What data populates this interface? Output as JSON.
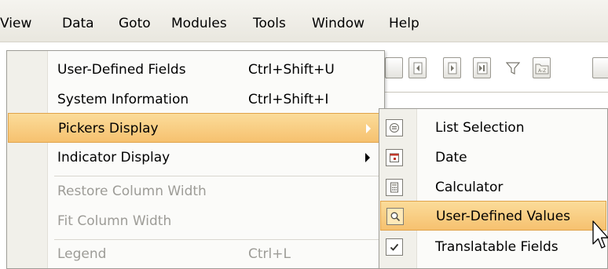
{
  "menubar": {
    "items": [
      {
        "label": "View"
      },
      {
        "label": "Data"
      },
      {
        "label": "Goto"
      },
      {
        "label": "Modules"
      },
      {
        "label": "Tools"
      },
      {
        "label": "Window"
      },
      {
        "label": "Help"
      }
    ]
  },
  "data_menu": {
    "items": [
      {
        "label": "User-Defined Fields",
        "shortcut": "Ctrl+Shift+U",
        "enabled": true
      },
      {
        "label": "System Information",
        "shortcut": "Ctrl+Shift+I",
        "enabled": true
      },
      {
        "label": "Pickers Display",
        "shortcut": "",
        "enabled": true,
        "submenu": true,
        "highlighted": true
      },
      {
        "label": "Indicator Display",
        "shortcut": "",
        "enabled": true,
        "submenu": true
      },
      {
        "label": "Restore Column Width",
        "shortcut": "",
        "enabled": false
      },
      {
        "label": "Fit Column Width",
        "shortcut": "",
        "enabled": false
      },
      {
        "label": "Legend",
        "shortcut": "Ctrl+L",
        "enabled": false
      }
    ]
  },
  "pickers_submenu": {
    "items": [
      {
        "label": "List Selection",
        "icon": "list-selection-icon"
      },
      {
        "label": "Date",
        "icon": "calendar-icon"
      },
      {
        "label": "Calculator",
        "icon": "calculator-icon"
      },
      {
        "label": "User-Defined Values",
        "icon": "magnifier-icon",
        "highlighted": true
      },
      {
        "label": "Translatable Fields",
        "icon": "checkmark-icon",
        "checked": true
      }
    ]
  },
  "colors": {
    "highlight": "#f6c16f",
    "menu_background": "#fbfbf9",
    "gutter": "#f1f0ea",
    "disabled_text": "#9d9c97"
  }
}
